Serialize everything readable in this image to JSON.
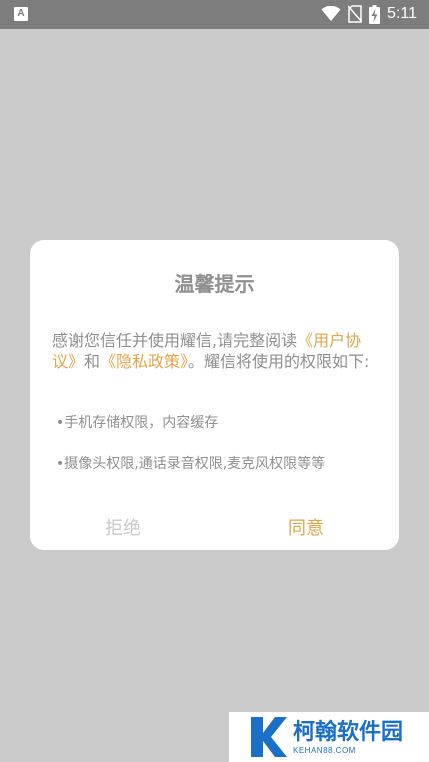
{
  "status_bar": {
    "left_icon_letter": "A",
    "time": "5:11",
    "icons": [
      "wifi-icon",
      "no-sim-icon",
      "battery-charging-icon"
    ]
  },
  "dialog": {
    "title": "温馨提示",
    "content_prefix": "感谢您信任并使用耀信,请完整阅读",
    "link_user_agreement": "《用户协议》",
    "and_text": "和",
    "link_privacy_policy": "《隐私政策》",
    "content_suffix": "。耀信将使用的权限如下:",
    "permissions": [
      "•手机存储权限，内容缓存",
      "•摄像头权限,通话录音权限,麦克风权限等等"
    ],
    "reject_label": "拒绝",
    "agree_label": "同意"
  },
  "colors": {
    "accent": "#e2a54b",
    "text_gray": "#8f8f8f",
    "overlay": "#cbcbcb",
    "status_bar": "#7d7d7d",
    "watermark_blue": "#1a6fc6"
  },
  "watermark": {
    "name": "柯翰软件园",
    "domain": "KEHAN88.COM"
  }
}
